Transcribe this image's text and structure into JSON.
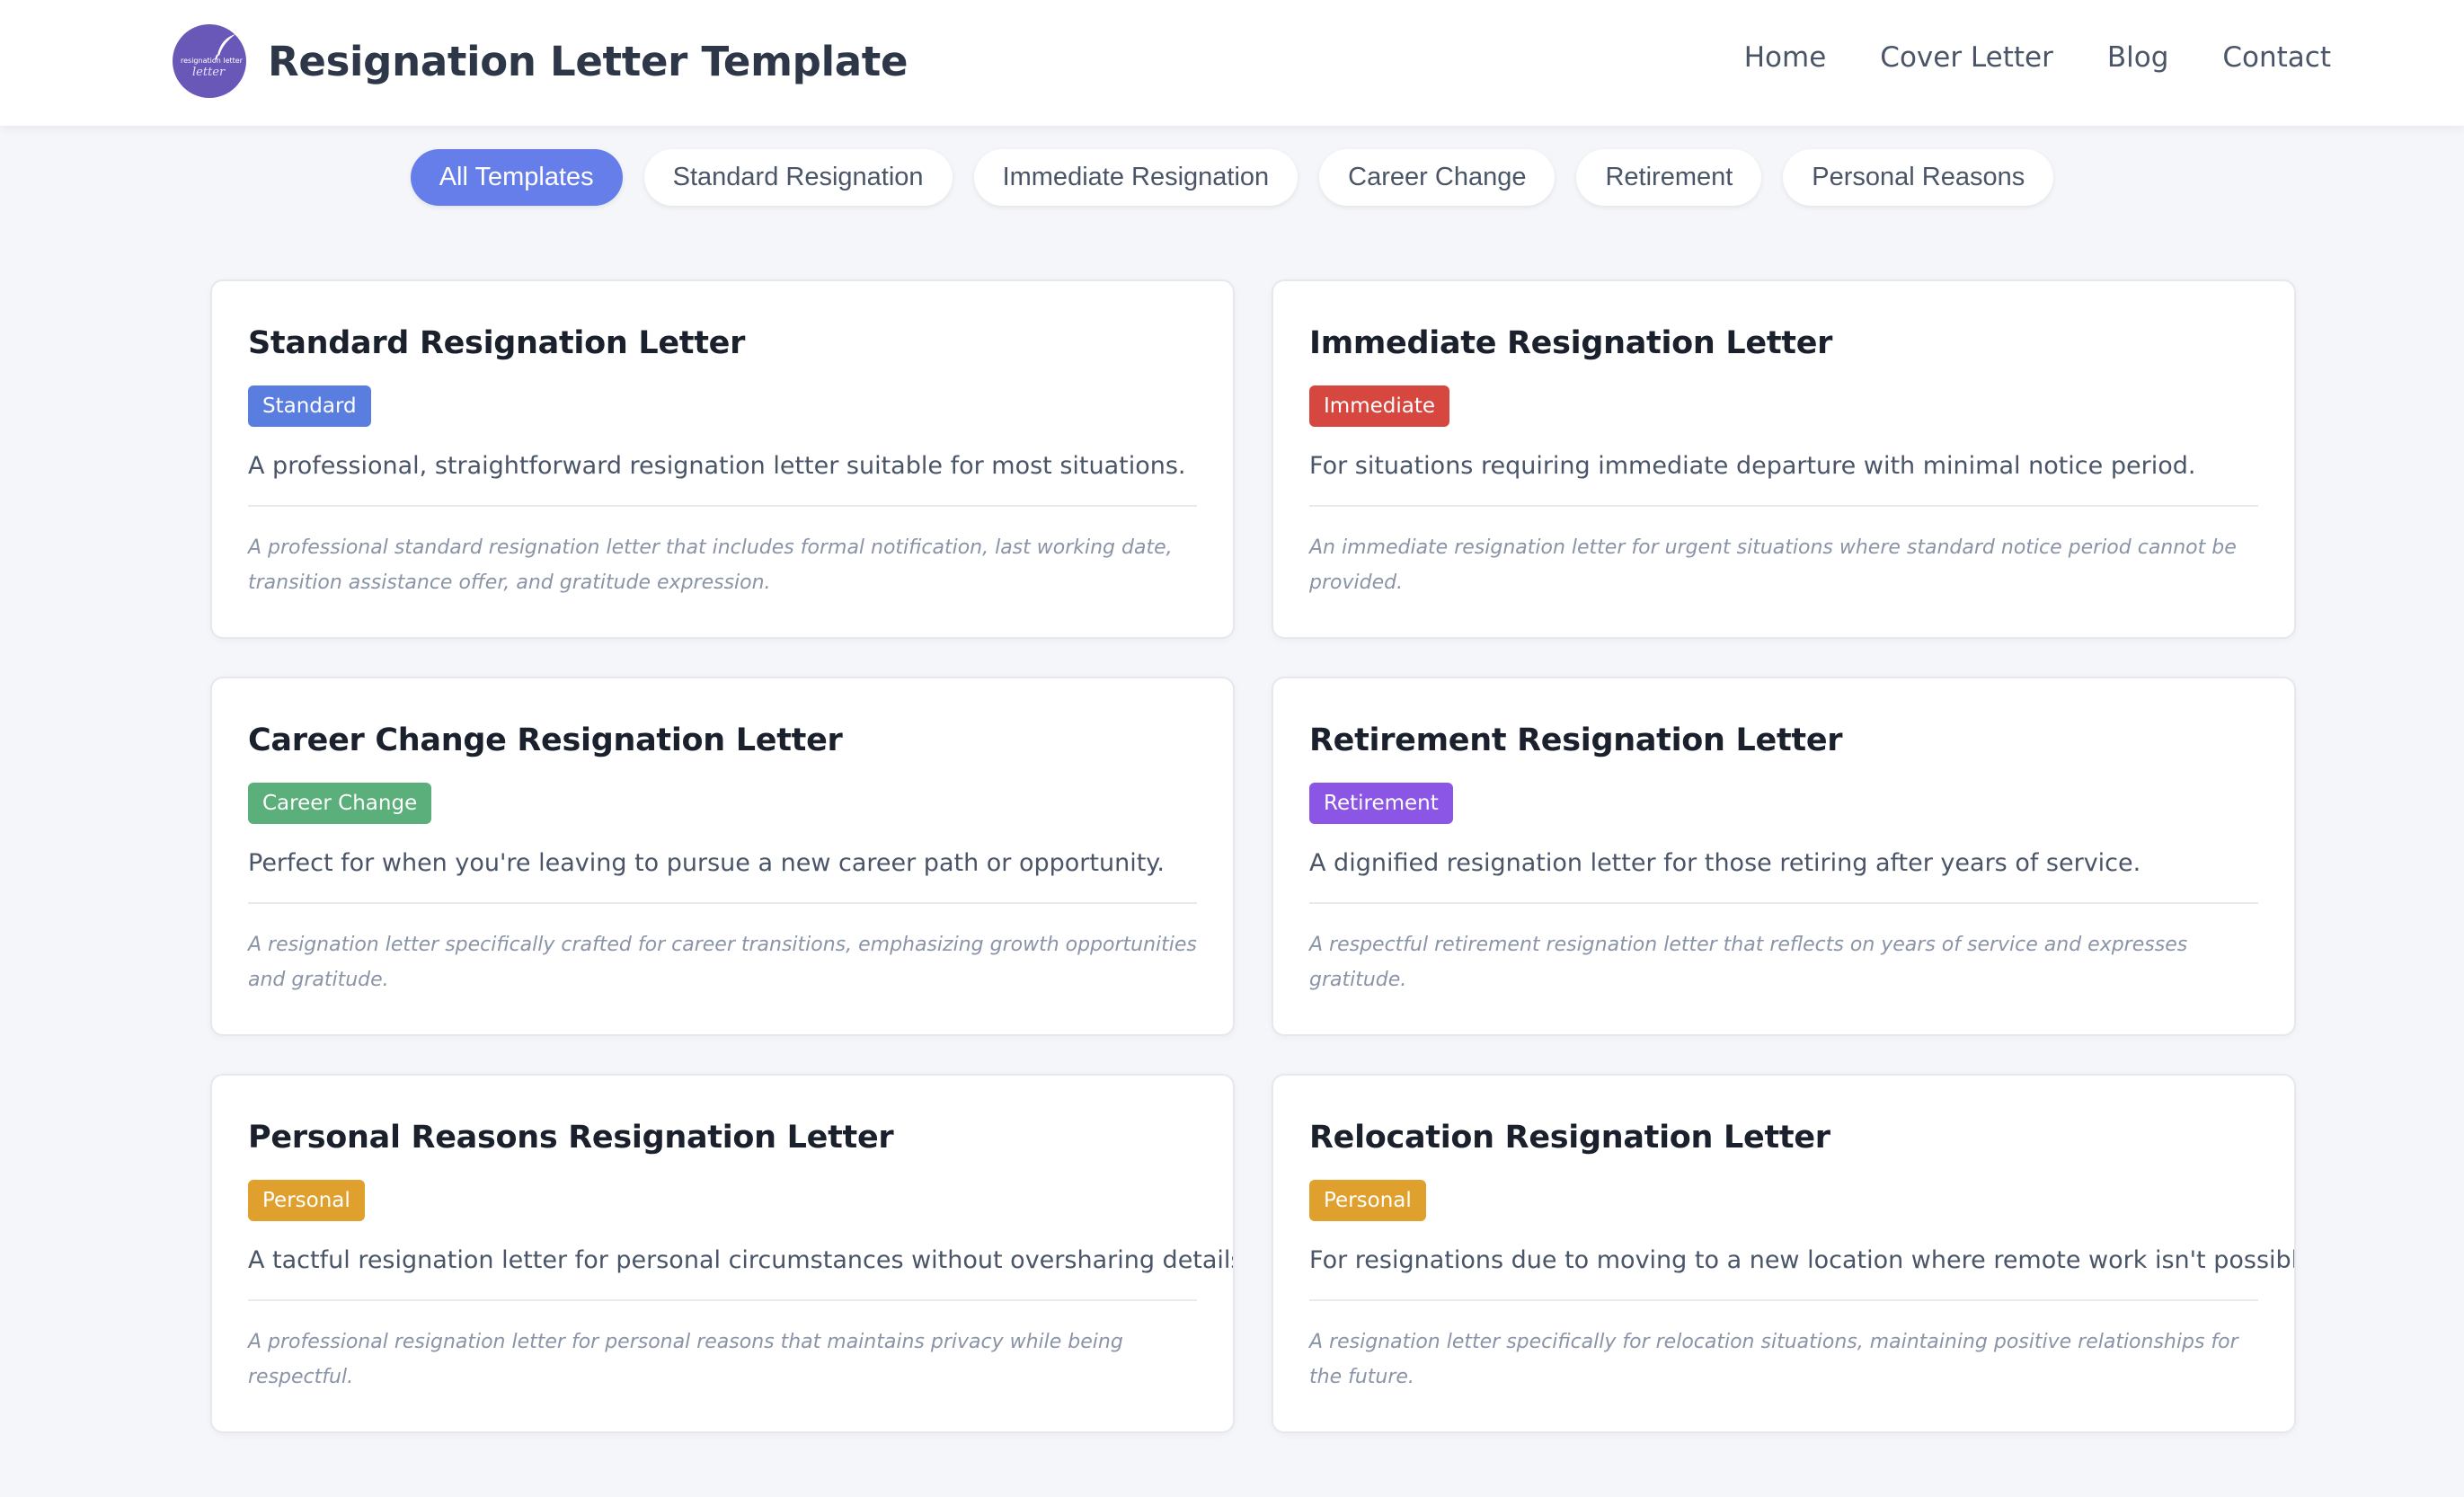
{
  "header": {
    "logo": {
      "line1": "resignation letter",
      "line2": "letter",
      "icon": "quill-icon"
    },
    "title": "Resignation Letter Template",
    "nav": [
      {
        "label": "Home"
      },
      {
        "label": "Cover Letter"
      },
      {
        "label": "Blog"
      },
      {
        "label": "Contact"
      }
    ]
  },
  "filters": [
    {
      "label": "All Templates",
      "active": true
    },
    {
      "label": "Standard Resignation",
      "active": false
    },
    {
      "label": "Immediate Resignation",
      "active": false
    },
    {
      "label": "Career Change",
      "active": false
    },
    {
      "label": "Retirement",
      "active": false
    },
    {
      "label": "Personal Reasons",
      "active": false
    }
  ],
  "colors": {
    "accent": "#667eea",
    "standard": "#5a7de0",
    "immediate": "#d5473f",
    "career": "#5aaf7a",
    "retirement": "#8b55e6",
    "personal": "#e0a02e"
  },
  "cards": [
    {
      "title": "Standard Resignation Letter",
      "badge": "Standard",
      "description": "A professional, straightforward resignation letter suitable for most situations.",
      "note": "A professional standard resignation letter that includes formal notification, last working date, transition assistance offer, and gratitude expression."
    },
    {
      "title": "Immediate Resignation Letter",
      "badge": "Immediate",
      "description": "For situations requiring immediate departure with minimal notice period.",
      "note": "An immediate resignation letter for urgent situations where standard notice period cannot be provided."
    },
    {
      "title": "Career Change Resignation Letter",
      "badge": "Career Change",
      "description": "Perfect for when you're leaving to pursue a new career path or opportunity.",
      "note": "A resignation letter specifically crafted for career transitions, emphasizing growth opportunities and gratitude."
    },
    {
      "title": "Retirement Resignation Letter",
      "badge": "Retirement",
      "description": "A dignified resignation letter for those retiring after years of service.",
      "note": "A respectful retirement resignation letter that reflects on years of service and expresses gratitude."
    },
    {
      "title": "Personal Reasons Resignation Letter",
      "badge": "Personal",
      "description": "A tactful resignation letter for personal circumstances without oversharing details.",
      "note": "A professional resignation letter for personal reasons that maintains privacy while being respectful."
    },
    {
      "title": "Relocation Resignation Letter",
      "badge": "Personal",
      "description": "For resignations due to moving to a new location where remote work isn't possible.",
      "note": "A resignation letter specifically for relocation situations, maintaining positive relationships for the future."
    }
  ]
}
